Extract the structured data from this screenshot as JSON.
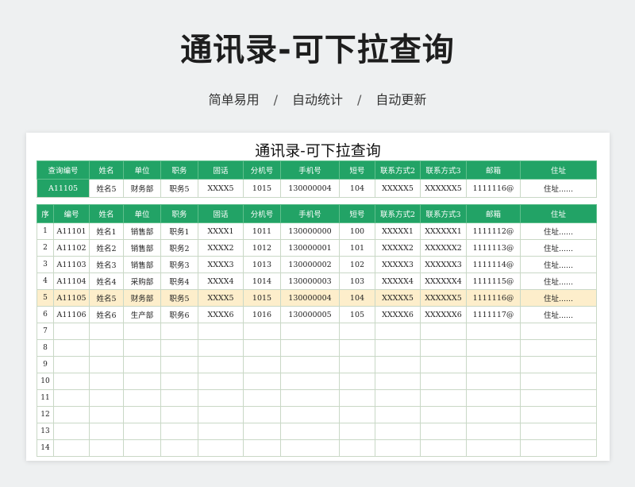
{
  "headline": "通讯录-可下拉查询",
  "tagline": [
    "简单易用",
    "自动统计",
    "自动更新"
  ],
  "tagline_separator": "/",
  "sheet": {
    "title": "通讯录-可下拉查询",
    "lookup": {
      "headers": [
        "查询编号",
        "姓名",
        "单位",
        "职务",
        "固话",
        "分机号",
        "手机号",
        "短号",
        "联系方式2",
        "联系方式3",
        "邮箱",
        "住址"
      ],
      "row": [
        "A11105",
        "姓名5",
        "财务部",
        "职务5",
        "XXXX5",
        "1015",
        "130000004",
        "104",
        "XXXXX5",
        "XXXXXX5",
        "1111116@",
        "住址......"
      ]
    },
    "table": {
      "headers": [
        "序",
        "编号",
        "姓名",
        "单位",
        "职务",
        "固话",
        "分机号",
        "手机号",
        "短号",
        "联系方式2",
        "联系方式3",
        "邮箱",
        "住址"
      ],
      "rows": [
        [
          "1",
          "A11101",
          "姓名1",
          "销售部",
          "职务1",
          "XXXX1",
          "1011",
          "130000000",
          "100",
          "XXXXX1",
          "XXXXXX1",
          "1111112@",
          "住址......"
        ],
        [
          "2",
          "A11102",
          "姓名2",
          "销售部",
          "职务2",
          "XXXX2",
          "1012",
          "130000001",
          "101",
          "XXXXX2",
          "XXXXXX2",
          "1111113@",
          "住址......"
        ],
        [
          "3",
          "A11103",
          "姓名3",
          "销售部",
          "职务3",
          "XXXX3",
          "1013",
          "130000002",
          "102",
          "XXXXX3",
          "XXXXXX3",
          "1111114@",
          "住址......"
        ],
        [
          "4",
          "A11104",
          "姓名4",
          "采购部",
          "职务4",
          "XXXX4",
          "1014",
          "130000003",
          "103",
          "XXXXX4",
          "XXXXXX4",
          "1111115@",
          "住址......"
        ],
        [
          "5",
          "A11105",
          "姓名5",
          "财务部",
          "职务5",
          "XXXX5",
          "1015",
          "130000004",
          "104",
          "XXXXX5",
          "XXXXXX5",
          "1111116@",
          "住址......"
        ],
        [
          "6",
          "A11106",
          "姓名6",
          "生产部",
          "职务6",
          "XXXX6",
          "1016",
          "130000005",
          "105",
          "XXXXX6",
          "XXXXXX6",
          "1111117@",
          "住址......"
        ],
        [
          "7",
          "",
          "",
          "",
          "",
          "",
          "",
          "",
          "",
          "",
          "",
          "",
          ""
        ],
        [
          "8",
          "",
          "",
          "",
          "",
          "",
          "",
          "",
          "",
          "",
          "",
          "",
          ""
        ],
        [
          "9",
          "",
          "",
          "",
          "",
          "",
          "",
          "",
          "",
          "",
          "",
          "",
          ""
        ],
        [
          "10",
          "",
          "",
          "",
          "",
          "",
          "",
          "",
          "",
          "",
          "",
          "",
          ""
        ],
        [
          "11",
          "",
          "",
          "",
          "",
          "",
          "",
          "",
          "",
          "",
          "",
          "",
          ""
        ],
        [
          "12",
          "",
          "",
          "",
          "",
          "",
          "",
          "",
          "",
          "",
          "",
          "",
          ""
        ],
        [
          "13",
          "",
          "",
          "",
          "",
          "",
          "",
          "",
          "",
          "",
          "",
          "",
          ""
        ],
        [
          "14",
          "",
          "",
          "",
          "",
          "",
          "",
          "",
          "",
          "",
          "",
          "",
          ""
        ]
      ],
      "highlighted_row": "5"
    }
  },
  "colors": {
    "header_green": "#22a366",
    "highlight": "#fdeecb",
    "background": "#eef0f1"
  }
}
